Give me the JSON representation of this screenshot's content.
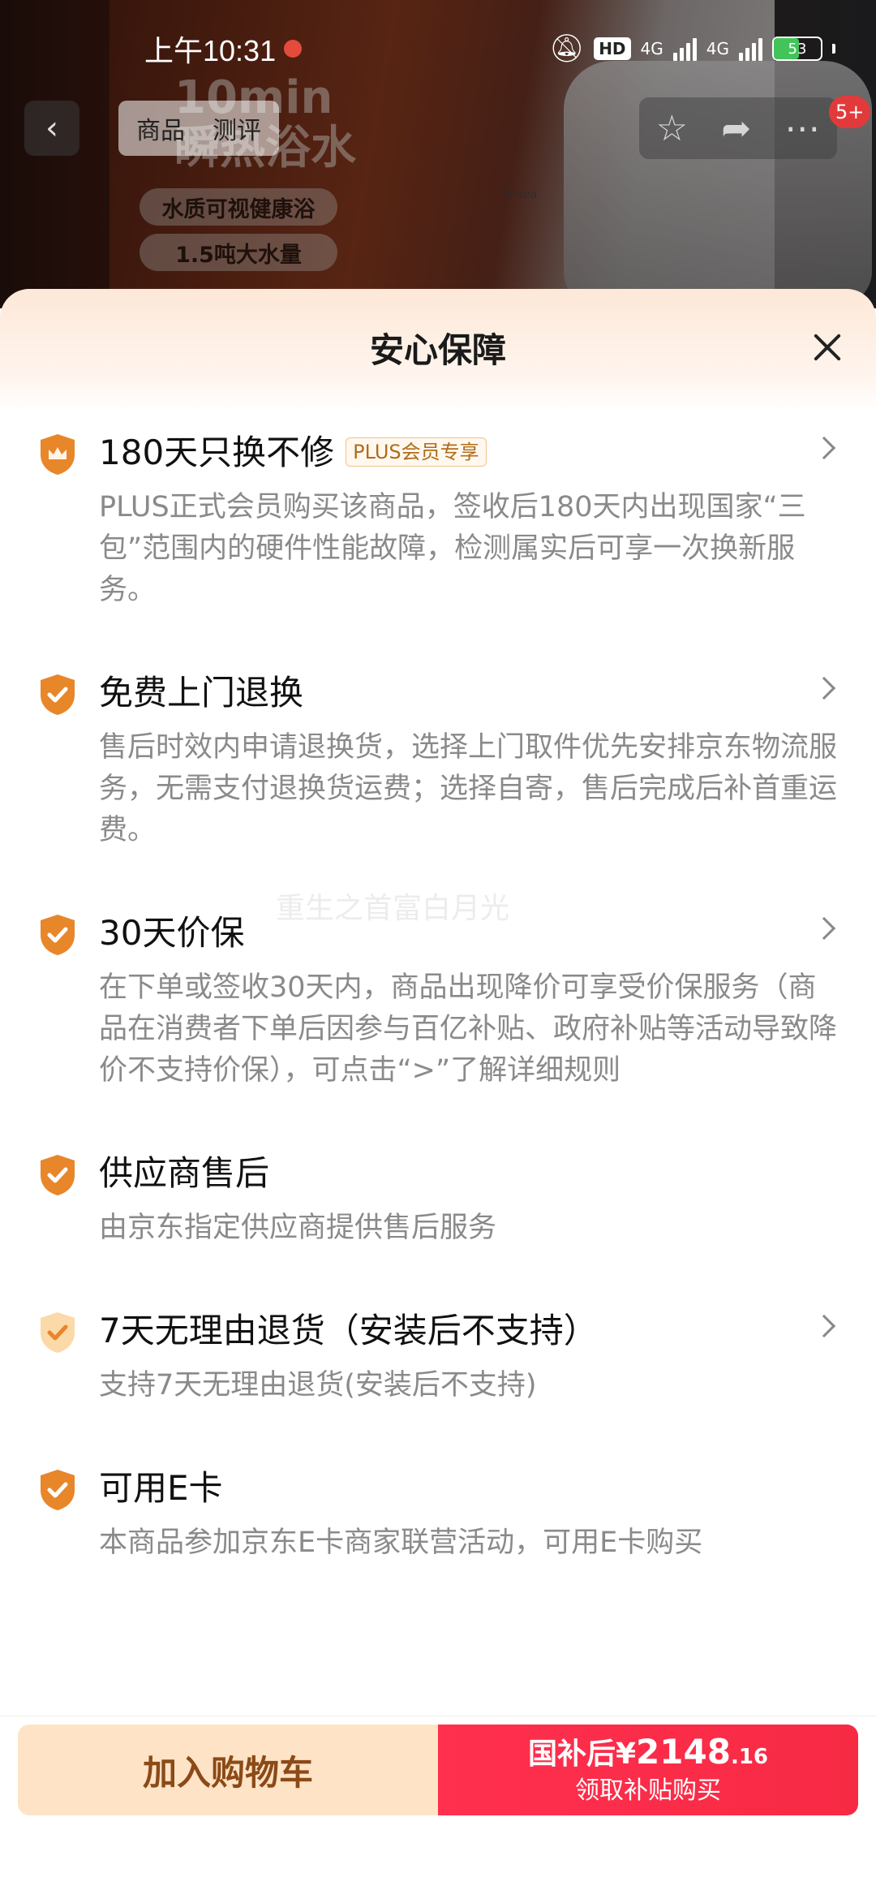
{
  "status_bar": {
    "time": "上午10:31",
    "hd_label": "HD",
    "network_1": "4G",
    "network_2": "4G",
    "battery": "53"
  },
  "background_page": {
    "nav_tabs": [
      "商品",
      "测评"
    ],
    "badge_count": "5+",
    "ad_headline_1": "10min",
    "ad_headline_2": "瞬热浴水",
    "ad_pill_1": "水质可视健康浴",
    "ad_pill_2": "1.5吨大水量",
    "heater_brand": "Midea"
  },
  "sheet": {
    "title": "安心保障",
    "items": [
      {
        "title": "180天只换不修",
        "tag": "PLUS会员专享",
        "desc": "PLUS正式会员购买该商品，签收后180天内出现国家“三包”范围内的硬件性能故障，检测属实后可享一次换新服务。",
        "has_chevron": true,
        "icon": "crown-shield-icon"
      },
      {
        "title": "免费上门退换",
        "desc": "售后时效内申请退换货，选择上门取件优先安排京东物流服务，无需支付退换货运费；选择自寄，售后完成后补首重运费。",
        "has_chevron": true,
        "icon": "check-shield-icon"
      },
      {
        "title": "30天价保",
        "desc": "在下单或签收30天内，商品出现降价可享受价保服务（商品在消费者下单后因参与百亿补贴、政府补贴等活动导致降价不支持价保），可点击“>”了解详细规则",
        "has_chevron": true,
        "icon": "check-shield-icon"
      },
      {
        "title": "供应商售后",
        "desc": "由京东指定供应商提供售后服务",
        "has_chevron": false,
        "icon": "check-shield-icon"
      },
      {
        "title": "7天无理由退货（安装后不支持）",
        "desc": "支持7天无理由退货(安装后不支持)",
        "has_chevron": true,
        "icon": "check-shield-light-icon"
      },
      {
        "title": "可用E卡",
        "desc": "本商品参加京东E卡商家联营活动，可用E卡购买",
        "has_chevron": false,
        "icon": "check-shield-icon"
      }
    ],
    "watermark": "重生之首富白月光"
  },
  "bottom_bar": {
    "add_to_cart": "加入购物车",
    "buy_prefix": "国补后¥",
    "buy_price_int": "2148",
    "buy_price_dec": ".16",
    "buy_sub": "领取补贴购买"
  },
  "colors": {
    "accent_red": "#f72a44",
    "shield_orange": "#e8862a",
    "cart_bg": "#ffe3c6",
    "cart_text": "#8b4a17"
  }
}
